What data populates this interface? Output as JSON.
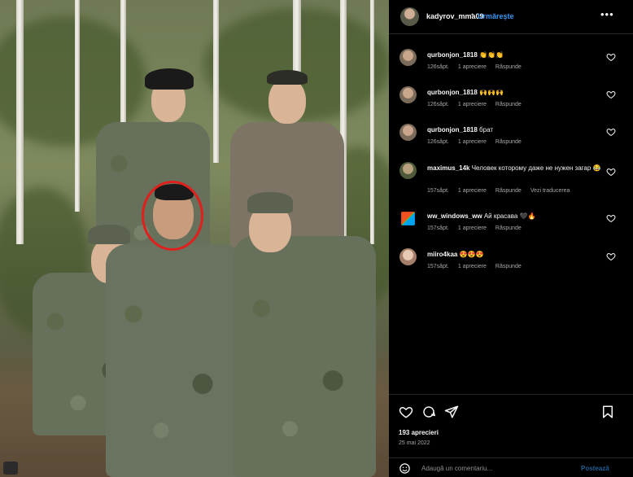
{
  "post": {
    "username": "kadyrov_mma09",
    "separator": "•",
    "follow_label": "Urmărește",
    "more_label": "•••"
  },
  "comments": [
    {
      "user": "qurbonjon_1818",
      "text": "👏👏👏",
      "age": "126săpt.",
      "likes": "1 apreciere",
      "reply": "Răspunde",
      "translate": ""
    },
    {
      "user": "qurbonjon_1818",
      "text": "🙌🙌🙌",
      "age": "126săpt.",
      "likes": "1 apreciere",
      "reply": "Răspunde",
      "translate": ""
    },
    {
      "user": "qurbonjon_1818",
      "text": "брат",
      "age": "126săpt.",
      "likes": "1 apreciere",
      "reply": "Răspunde",
      "translate": ""
    },
    {
      "user": "maximus_14k",
      "text": "Человек которому даже не нужен загар 😂",
      "age": "157săpt.",
      "likes": "1 apreciere",
      "reply": "Răspunde",
      "translate": "Vezi traducerea"
    },
    {
      "user": "ww_windows_ww",
      "text": "Ай красава 🖤🔥",
      "age": "157săpt.",
      "likes": "1 apreciere",
      "reply": "Răspunde",
      "translate": ""
    },
    {
      "user": "miiro4kaa",
      "text": "😍😍😍",
      "age": "157săpt.",
      "likes": "1 apreciere",
      "reply": "Răspunde",
      "translate": ""
    }
  ],
  "stats": {
    "likes": "193 aprecieri",
    "date": "25 mai 2022"
  },
  "composer": {
    "placeholder": "Adaugă un comentariu...",
    "post_label": "Postează"
  },
  "colors": {
    "accent": "#3897f0",
    "highlight_circle": "#e0201c",
    "background": "#000000"
  },
  "icons": [
    "more-icon",
    "heart-icon",
    "comment-icon",
    "share-icon",
    "bookmark-icon",
    "smile-icon"
  ]
}
